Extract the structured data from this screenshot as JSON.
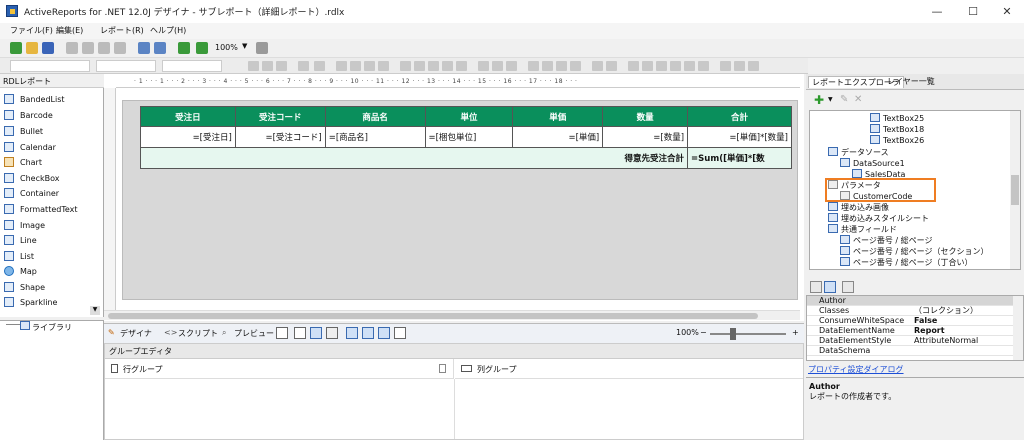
{
  "window": {
    "title": "ActiveReports for .NET 12.0J デザイナ - サブレポート（詳細レポート）.rdlx",
    "minimize": "—",
    "maximize": "☐",
    "close": "✕"
  },
  "menu": [
    "ファイル(F)",
    "編集(E)",
    "レポート(R)",
    "ヘルプ(H)"
  ],
  "toolbar": {
    "zoom": "100%"
  },
  "toolbox": {
    "header": "RDLレポート",
    "items": [
      "BandedList",
      "Barcode",
      "Bullet",
      "Calendar",
      "Chart",
      "CheckBox",
      "Container",
      "FormattedText",
      "Image",
      "Line",
      "List",
      "Map",
      "Shape",
      "Sparkline"
    ],
    "library": "ライブラリ"
  },
  "report": {
    "headers": [
      "受注日",
      "受注コード",
      "商品名",
      "単位",
      "単価",
      "数量",
      "合計"
    ],
    "details": [
      "=[受注日]",
      "=[受注コード]",
      "=[商品名]",
      "=[梱包単位]",
      "=[単価]",
      "=[数量]",
      "=[単価]*[数量]"
    ],
    "total_label": "得意先受注合計",
    "total_expr": "=Sum([単価]*[数"
  },
  "ruler": "· 1 · · · 1 · · · 2 · · · 3 · · · 4 · · · 5 · · · 6 · · · 7 · · · 8 · · · 9 · · · 10 · · · 11 · · · 12 · · · 13 · · · 14 · · · 15 · · · 16 · · · 17 · · · 18 · · ·",
  "bottom_tabs": {
    "design": "デザイナ",
    "script": "スクリプト",
    "preview": "プレビュー",
    "zoom": "100%"
  },
  "group_editor": {
    "title": "グループエディタ",
    "row_group": "行グループ",
    "col_group": "列グループ"
  },
  "explorer": {
    "tabs": [
      "レポートエクスプローラ",
      "レイヤー一覧"
    ],
    "tree": [
      "TextBox25",
      "TextBox18",
      "TextBox26",
      "データソース",
      "DataSource1",
      "SalesData",
      "パラメータ",
      "CustomerCode",
      "埋め込み画像",
      "埋め込みスタイルシート",
      "共通フィールド",
      "ページ番号 / 総ページ",
      "ページ番号 / 総ページ（セクション）",
      "ページ番号 / 総ページ（丁合い）"
    ]
  },
  "properties": {
    "rows": [
      {
        "name": "Author",
        "value": ""
      },
      {
        "name": "Classes",
        "value": "（コレクション）"
      },
      {
        "name": "ConsumeWhiteSpace",
        "value": "False"
      },
      {
        "name": "DataElementName",
        "value": "Report"
      },
      {
        "name": "DataElementStyle",
        "value": "AttributeNormal"
      },
      {
        "name": "DataSchema",
        "value": ""
      }
    ],
    "link": "プロパティ設定ダイアログ",
    "desc_title": "Author",
    "desc_text": "レポートの作成者です。"
  }
}
